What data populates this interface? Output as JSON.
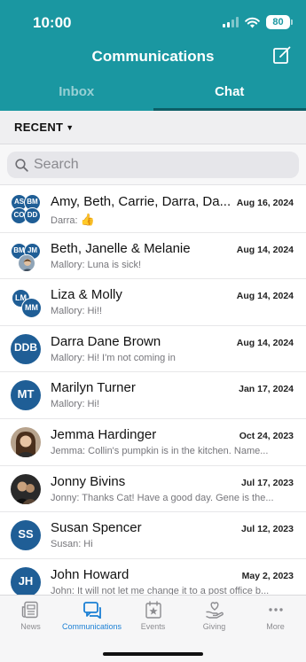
{
  "status_bar": {
    "time": "10:00",
    "battery": "80"
  },
  "header": {
    "title": "Communications",
    "compose_icon": "compose-icon"
  },
  "tabs": [
    {
      "label": "Inbox",
      "active": false
    },
    {
      "label": "Chat",
      "active": true
    }
  ],
  "filter": {
    "label": "RECENT"
  },
  "search": {
    "placeholder": "Search",
    "value": ""
  },
  "conversations": [
    {
      "name": "Amy, Beth, Carrie, Darra, Da...",
      "date": "Aug 16, 2024",
      "preview": "Darra:",
      "preview_icon": "thumbs-up-emoji",
      "avatar": {
        "type": "group4",
        "initials": [
          "AS",
          "BM",
          "CO",
          "DD"
        ]
      }
    },
    {
      "name": "Beth, Janelle & Melanie",
      "date": "Aug 14, 2024",
      "preview": "Mallory: Luna is sick!",
      "avatar": {
        "type": "group-photo",
        "initials": [
          "BM",
          "JM"
        ]
      }
    },
    {
      "name": "Liza & Molly",
      "date": "Aug 14, 2024",
      "preview": "Mallory: Hi!!",
      "avatar": {
        "type": "group2",
        "initials": [
          "LM",
          "MM"
        ]
      }
    },
    {
      "name": "Darra Dane Brown",
      "date": "Aug 14, 2024",
      "preview": "Mallory: Hi! I'm not coming in",
      "avatar": {
        "type": "initials",
        "initials": [
          "DDB"
        ]
      }
    },
    {
      "name": "Marilyn Turner",
      "date": "Jan 17, 2024",
      "preview": "Mallory: Hi!",
      "avatar": {
        "type": "initials",
        "initials": [
          "MT"
        ]
      }
    },
    {
      "name": "Jemma Hardinger",
      "date": "Oct 24, 2023",
      "preview": "Jemma: Collin's pumpkin is in the kitchen. Name...",
      "avatar": {
        "type": "photo"
      }
    },
    {
      "name": "Jonny Bivins",
      "date": "Jul 17, 2023",
      "preview": "Jonny: Thanks  Cat! Have a good day. Gene is the...",
      "avatar": {
        "type": "photo"
      }
    },
    {
      "name": "Susan Spencer",
      "date": "Jul 12, 2023",
      "preview": "Susan: Hi",
      "avatar": {
        "type": "initials",
        "initials": [
          "SS"
        ]
      }
    },
    {
      "name": "John Howard",
      "date": "May 2, 2023",
      "preview": "John: It will not let me change it to a post office b...",
      "avatar": {
        "type": "initials",
        "initials": [
          "JH"
        ]
      }
    }
  ],
  "tabbar": [
    {
      "label": "News",
      "icon": "news-icon",
      "active": false
    },
    {
      "label": "Communications",
      "icon": "chat-icon",
      "active": true
    },
    {
      "label": "Events",
      "icon": "calendar-star-icon",
      "active": false
    },
    {
      "label": "Giving",
      "icon": "heart-hand-icon",
      "active": false
    },
    {
      "label": "More",
      "icon": "more-icon",
      "active": false
    }
  ],
  "colors": {
    "header": "#1a97a1",
    "avatar": "#1f5e96",
    "active_tab": "#1a7fd4"
  }
}
